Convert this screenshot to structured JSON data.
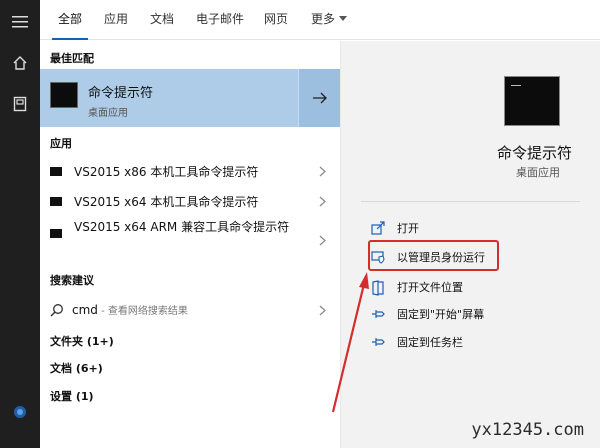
{
  "tabs": [
    {
      "label": "全部",
      "active": true
    },
    {
      "label": "应用"
    },
    {
      "label": "文档"
    },
    {
      "label": "电子邮件"
    },
    {
      "label": "网页"
    },
    {
      "label": "更多"
    }
  ],
  "rail": {
    "menu_icon": "hamburger-icon",
    "home_icon": "home-icon",
    "docs_icon": "document-icon",
    "cortana_icon": "cortana-icon"
  },
  "best_match": {
    "section": "最佳匹配",
    "title": "命令提示符",
    "subtitle": "桌面应用",
    "icon": "console-icon"
  },
  "apps": {
    "section": "应用",
    "items": [
      {
        "label": "VS2015 x86 本机工具命令提示符"
      },
      {
        "label": "VS2015 x64 本机工具命令提示符"
      },
      {
        "label": "VS2015 x64 ARM 兼容工具命令提示符"
      }
    ]
  },
  "search_suggest": {
    "section": "搜索建议",
    "query": "cmd",
    "hint": " - 查看网络搜索结果"
  },
  "categories": [
    {
      "label": "文件夹 (1+)"
    },
    {
      "label": "文档 (6+)"
    },
    {
      "label": "设置 (1)"
    }
  ],
  "detail": {
    "title": "命令提示符",
    "subtitle": "桌面应用",
    "actions": [
      {
        "label": "打开",
        "icon": "open-icon"
      },
      {
        "label": "以管理员身份运行",
        "icon": "shield-icon"
      },
      {
        "label": "打开文件位置",
        "icon": "folder-icon"
      },
      {
        "label": "固定到\"开始\"屏幕",
        "icon": "pin-icon"
      },
      {
        "label": "固定到任务栏",
        "icon": "pin-icon"
      }
    ]
  },
  "colors": {
    "accent": "#1a5fb4",
    "best_bg": "#aecce8",
    "highlight": "#d42d2d"
  },
  "watermark": "yx12345.com"
}
